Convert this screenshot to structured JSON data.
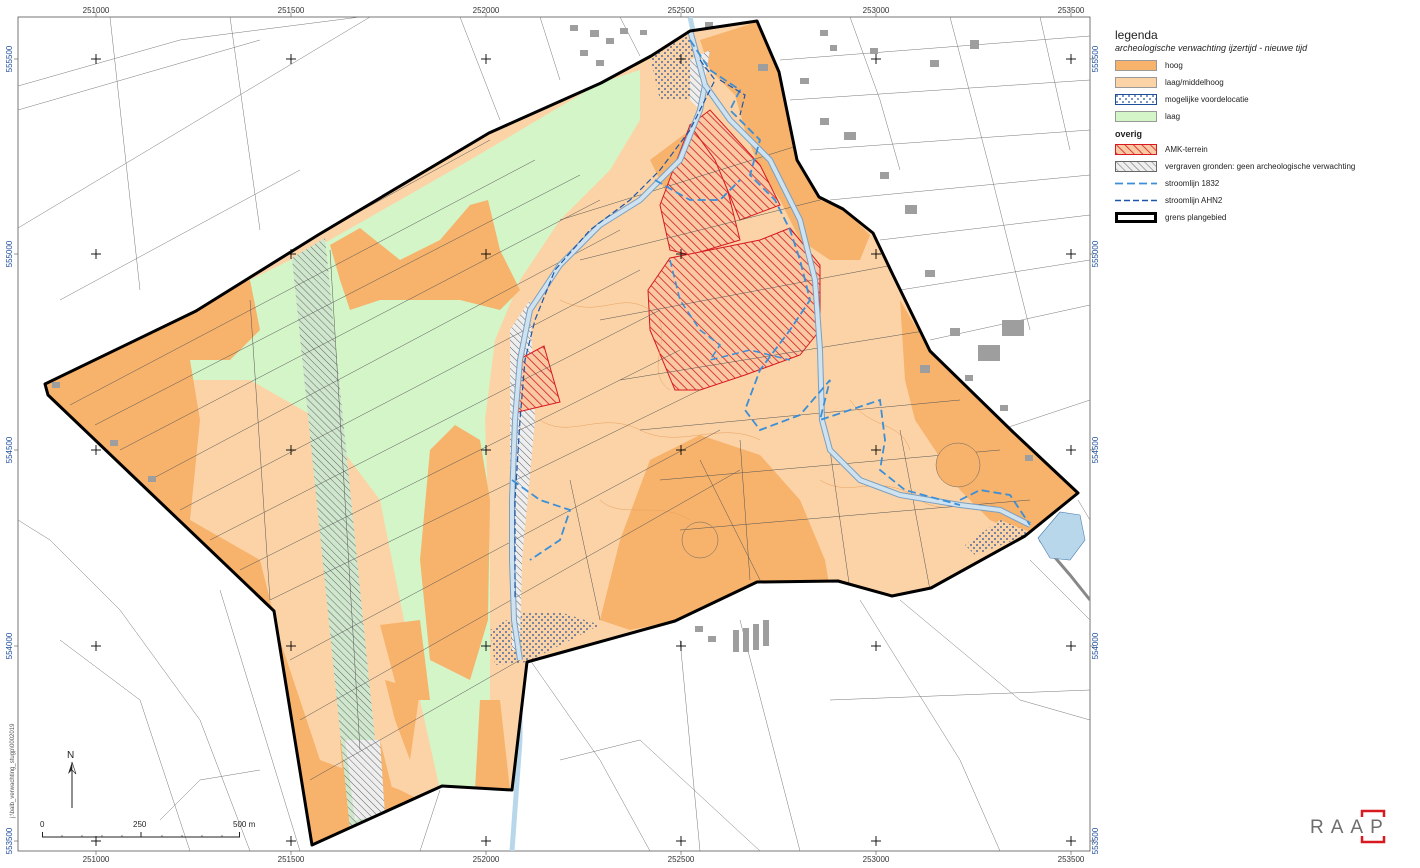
{
  "map": {
    "x_coords": [
      "251000",
      "251500",
      "252000",
      "252500",
      "253000",
      "253500"
    ],
    "y_coords": [
      "555500",
      "555000",
      "554500",
      "554000",
      "553500"
    ],
    "colors": {
      "hoog": "#f7b26b",
      "laag_middelhoog": "#fcd3a6",
      "laag": "#d4f5c8",
      "amk": "#d71920",
      "stream": "#3a79d6",
      "boundary": "#000000",
      "water": "#b9d7ea"
    }
  },
  "legend": {
    "title": "legenda",
    "subtitle": "archeologische verwachting ijzertijd - nieuwe tijd",
    "items": [
      {
        "label": "hoog",
        "symbol": "fill-orange"
      },
      {
        "label": "laag/middelhoog",
        "symbol": "fill-light-orange"
      },
      {
        "label": "mogelijke voordelocatie",
        "symbol": "dotted-fill"
      },
      {
        "label": "laag",
        "symbol": "fill-green"
      }
    ],
    "overig_title": "overig",
    "overig_items": [
      {
        "label": "AMK-terrein",
        "symbol": "red-hatch"
      },
      {
        "label": "vergraven gronden: geen archeologische verwachting",
        "symbol": "grey-hatch"
      },
      {
        "label": "stroomlijn 1832",
        "symbol": "dashed-blue-line"
      },
      {
        "label": "stroomlijn AHN2",
        "symbol": "dashed-navy-line"
      },
      {
        "label": "grens plangebied",
        "symbol": "thick-black-line"
      }
    ]
  },
  "scalebar": {
    "labels": [
      "0",
      "250",
      "500 m"
    ]
  },
  "north_arrow": {
    "label": "N"
  },
  "logo": {
    "text": "RAAP"
  },
  "side_note": "j:\\balb_verwachting_stugp\\0002019"
}
